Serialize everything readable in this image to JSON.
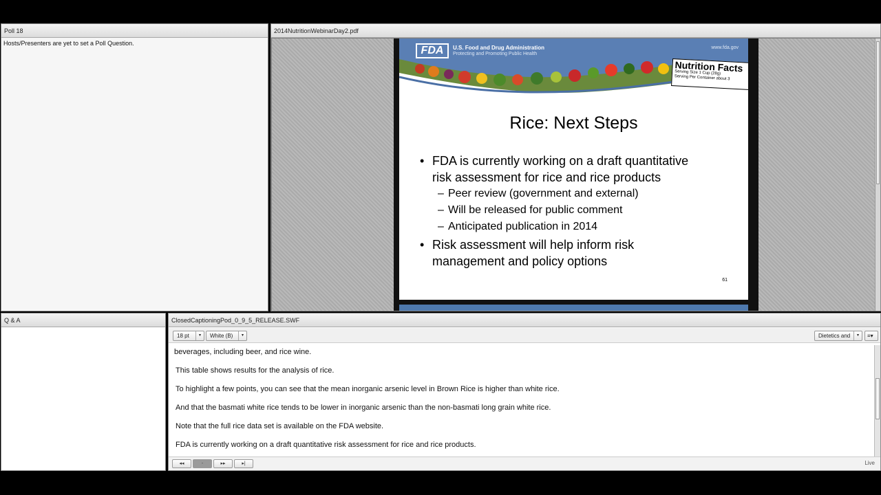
{
  "poll_pod": {
    "title": "Poll 18",
    "message": "Hosts/Presenters are yet to set a Poll Question."
  },
  "share_pod": {
    "title": "2014NutritionWebinarDay2.pdf",
    "slide": {
      "agency_logo": "FDA",
      "agency_name": "U.S. Food and Drug Administration",
      "agency_tagline": "Protecting and Promoting Public Health",
      "agency_url": "www.fda.gov",
      "nutrition_label": {
        "title": "Nutrition Facts",
        "line1": "Serving Size 1 Cup (28g)",
        "line2": "Serving Per Container about 3"
      },
      "title": "Rice: Next Steps",
      "bullets": [
        {
          "line1": "FDA is currently working on a draft quantitative",
          "line2": "risk assessment for rice and rice products",
          "sub": [
            "Peer review (government and external)",
            "Will be released for public comment",
            "Anticipated publication in 2014"
          ]
        },
        {
          "line1": "Risk assessment will help inform risk",
          "line2": "management and policy options"
        }
      ],
      "page_number": "61",
      "bullet_glyph": "•",
      "dash_glyph": "–"
    }
  },
  "qa_pod": {
    "title": "Q & A"
  },
  "cc_pod": {
    "title": "ClosedCaptioningPod_0_9_5_RELEASE.SWF",
    "font_size": "18 pt",
    "color": "White (B)",
    "language": "Dietetics and",
    "menu_icon": "≡▾",
    "lines": [
      "beverages, including beer, and rice wine.",
      "This table shows results for the analysis of rice.",
      "To highlight a few points, you can see that the mean inorganic arsenic level in Brown Rice is higher than white rice.",
      "And that the basmati white rice tends to be lower in inorganic arsenic than the non-basmati long grain white rice.",
      "Note that the full rice data set is available on the FDA website.",
      "FDA is currently working on a draft quantitative risk assessment for rice and rice products."
    ],
    "nav": {
      "first": "◂◂",
      "pause": "-",
      "next": "▸▸",
      "last": "▸|"
    },
    "status": "Live"
  }
}
